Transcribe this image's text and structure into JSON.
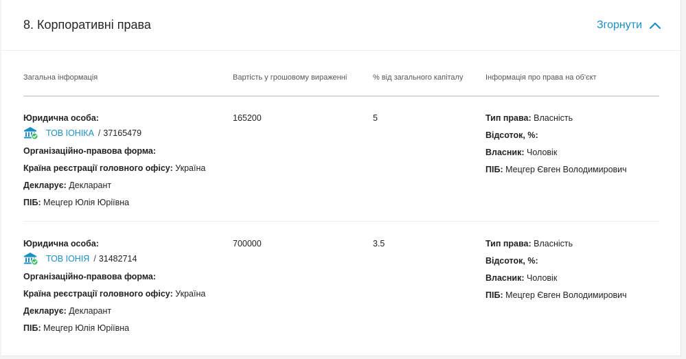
{
  "section": {
    "title": "8. Корпоративні права",
    "collapse_label": "Згорнути"
  },
  "columns": [
    "Загальна інформація",
    "Вартість у грошовому вираженні",
    "% від загального капіталу",
    "Інформація про права на об'єкт"
  ],
  "labels": {
    "legal_entity": "Юридична особа:",
    "org_form": "Організаційно-правова форма:",
    "country": "Країна реєстрації головного офісу:",
    "declarant": "Декларує:",
    "pib": "ПІБ:",
    "right_type": "Тип права:",
    "percent": "Відсоток, %:",
    "owner": "Власник:"
  },
  "rows": [
    {
      "entity_name": "ТОВ ІОНІКА",
      "entity_code": "37165479",
      "country": "Україна",
      "declarant": "Декларант",
      "pib": "Мецгер Юлія Юріївна",
      "value": "165200",
      "capital_percent": "5",
      "right_type": "Власність",
      "owner": "Чоловік",
      "owner_pib": "Мецгер Євген Володимирович"
    },
    {
      "entity_name": "ТОВ ІОНІЯ",
      "entity_code": "31482714",
      "country": "Україна",
      "declarant": "Декларант",
      "pib": "Мецгер Юлія Юріївна",
      "value": "700000",
      "capital_percent": "3.5",
      "right_type": "Власність",
      "owner": "Чоловік",
      "owner_pib": "Мецгер Євген Володимирович"
    }
  ],
  "colors": {
    "accent": "#1b8fc4",
    "verified": "#3dbb61"
  },
  "icons": {
    "entity": "bank-building-icon",
    "verified": "check-badge-icon",
    "collapse": "chevron-up-icon"
  }
}
